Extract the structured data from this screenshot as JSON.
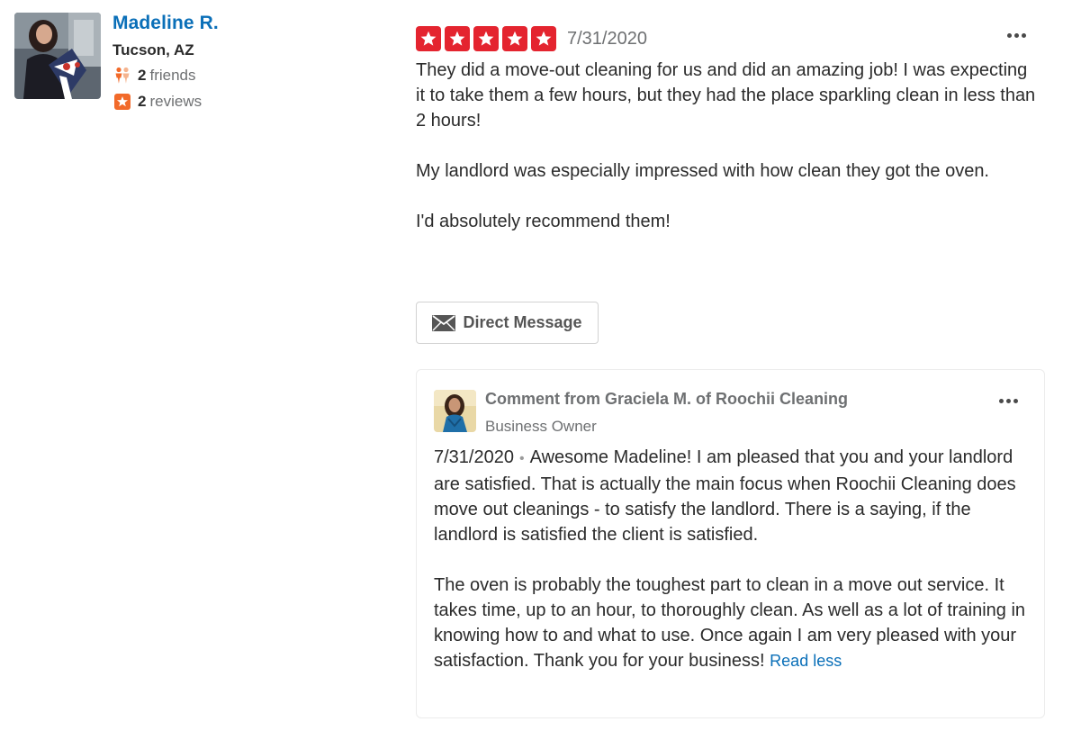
{
  "user": {
    "name": "Madeline R.",
    "location": "Tucson, AZ",
    "friends_count": "2",
    "friends_label": "friends",
    "reviews_count": "2",
    "reviews_label": "reviews",
    "avatar_icon": "user-photo",
    "friends_icon": "friends-icon",
    "reviews_icon": "review-star-icon"
  },
  "review": {
    "rating": 5,
    "max_rating": 5,
    "date": "7/31/2020",
    "paragraphs": [
      "They did a move-out cleaning for us and did an amazing job! I was expecting it to take them a few hours, but they had the place sparkling clean in less than 2 hours!",
      "My landlord was especially impressed with how clean they got the oven.",
      "I'd absolutely recommend them!"
    ],
    "direct_message_label": "Direct Message"
  },
  "comment": {
    "title": "Comment from Graciela M. of Roochii Cleaning",
    "role": "Business Owner",
    "date": "7/31/2020",
    "paragraph1": "Awesome Madeline! I am pleased that you and your landlord are satisfied. That is actually the main focus when Roochii Cleaning does move out cleanings - to satisfy the landlord. There is a saying, if the landlord is satisfied the client is satisfied.",
    "paragraph2": "The oven is probably the toughest part to clean in a move out service. It takes time, up to an hour, to thoroughly clean. As well as a lot of training in knowing how to and what to use. Once again I am very pleased with your satisfaction. Thank you for your business!",
    "read_less_label": "Read less"
  },
  "colors": {
    "link_blue": "#0a6fb8",
    "star_red": "#e4242f",
    "friends_orange": "#f26a2a",
    "muted_text": "#6e7072"
  }
}
